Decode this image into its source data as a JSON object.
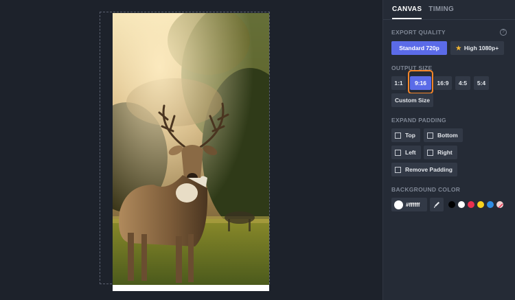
{
  "tabs": [
    {
      "label": "CANVAS",
      "active": true
    },
    {
      "label": "TIMING",
      "active": false
    }
  ],
  "export_quality": {
    "label": "EXPORT QUALITY",
    "options": [
      "Standard 720p",
      "High 1080p+"
    ],
    "selected": "Standard 720p"
  },
  "output_size": {
    "label": "OUTPUT SIZE",
    "options": [
      "1:1",
      "9:16",
      "16:9",
      "4:5",
      "5:4"
    ],
    "custom_label": "Custom Size",
    "selected": "9:16"
  },
  "expand_padding": {
    "label": "EXPAND PADDING",
    "top": "Top",
    "bottom": "Bottom",
    "left": "Left",
    "right": "Right",
    "remove": "Remove Padding"
  },
  "background_color": {
    "label": "BACKGROUND COLOR",
    "value": "#ffffff",
    "swatches": [
      "#000000",
      "#ffffff",
      "#e8304f",
      "#f7d21e",
      "#2f8de4",
      "transparent"
    ]
  },
  "colors": {
    "accent": "#5b6be8",
    "highlight": "#f5862a",
    "panel_bg": "#252b36"
  },
  "icons": {
    "help": "question-circle-icon",
    "eyedropper": "eyedropper-icon",
    "star": "star-icon"
  }
}
